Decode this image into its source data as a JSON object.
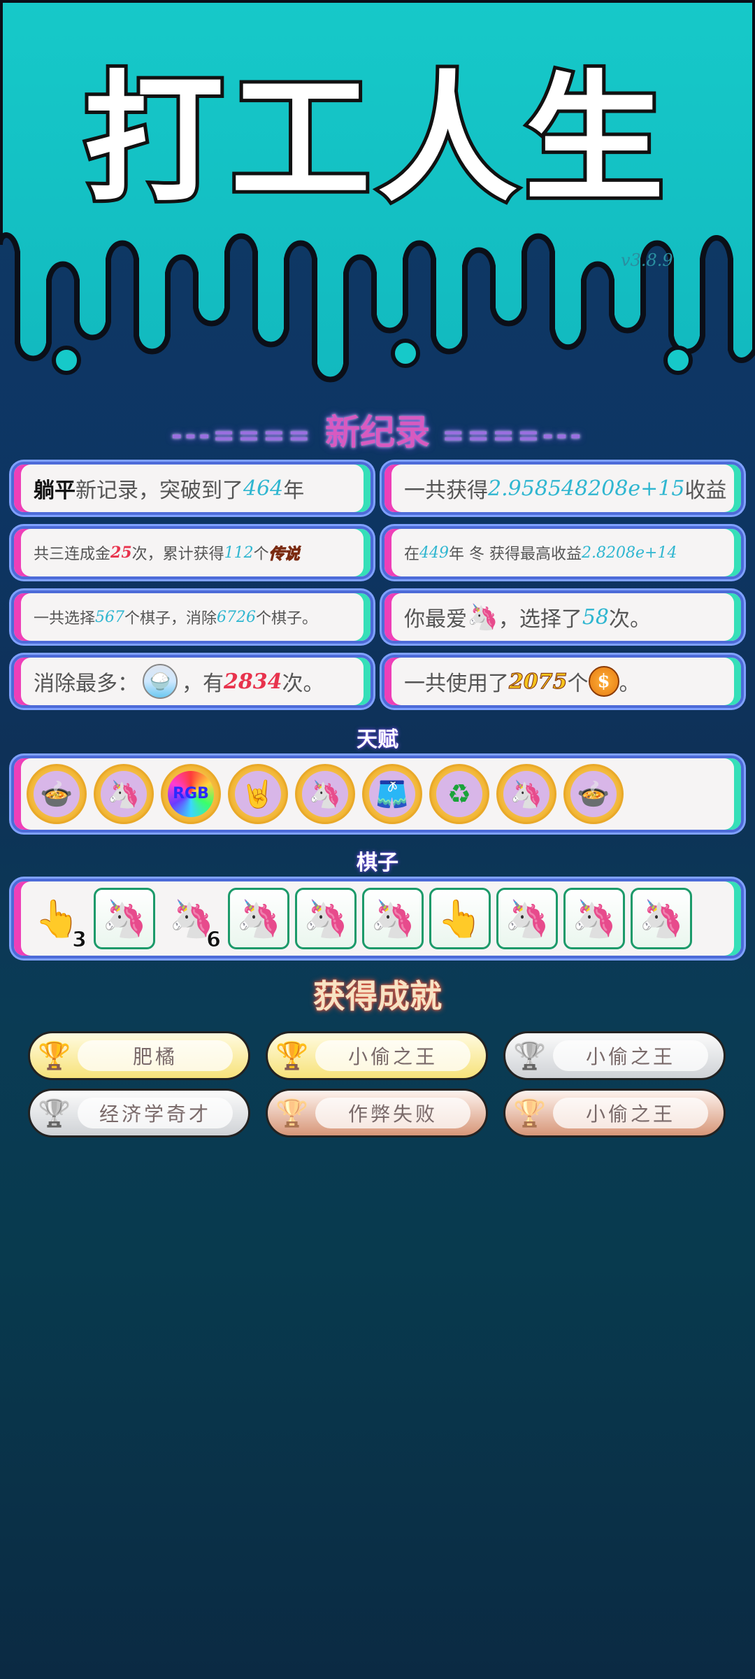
{
  "app": {
    "title": "打工人生",
    "version": "v3.8.9"
  },
  "colors": {
    "top_band": "#14c4c6",
    "card_border": "#4d6bd8",
    "card_left_accent": "#ee3fb8",
    "card_right_accent": "#35dfb8",
    "number_cyan": "#2fb6d0",
    "number_red": "#e8334d"
  },
  "record_header": {
    "left_dashes": "---====",
    "label": "新纪录",
    "right_dashes": "====---"
  },
  "records": [
    {
      "prefix_bold": "躺平",
      "text_a": "新记录，突破到了",
      "num": "464",
      "text_b": "年"
    },
    {
      "text_a": "一共获得",
      "num": "2.958548208e+15",
      "text_b": "收益"
    },
    {
      "text_a": "共三连成金",
      "num": "25",
      "text_b": "次，累计获得",
      "num2": "112",
      "text_c": "个",
      "tag": "传说"
    },
    {
      "text_a": "在",
      "num": "449",
      "text_b": "年 冬 获得最高收益",
      "num2": "2.8208e+14"
    },
    {
      "text_a": "一共选择",
      "num": "567",
      "text_b": "个棋子，消除",
      "num2": "6726",
      "text_c": "个棋子。"
    },
    {
      "text_a": "你最爱",
      "icon": "unicorn-icon",
      "text_b": "，选择了",
      "num": "58",
      "text_c": "次。"
    },
    {
      "text_a": "消除最多：",
      "icon": "rice-bowl-icon",
      "text_b": "，有",
      "num": "2834",
      "text_c": "次。"
    },
    {
      "text_a": "一共使用了",
      "num": "2075",
      "text_b": "个",
      "icon": "coin-icon",
      "coin_symbol": "$",
      "text_c": "。"
    }
  ],
  "talents": {
    "label": "天赋",
    "items": [
      {
        "icon": "bowl-split-icon",
        "glyph": "🍲"
      },
      {
        "icon": "unicorn-coin-icon",
        "glyph": "🦄"
      },
      {
        "icon": "rgb-icon",
        "glyph": "RGB"
      },
      {
        "icon": "rock-hand-icon",
        "glyph": "🤘"
      },
      {
        "icon": "unicorn-coin-icon",
        "glyph": "🦄"
      },
      {
        "icon": "skirt-icon",
        "glyph": "🩳"
      },
      {
        "icon": "recycle-icon",
        "glyph": "♻"
      },
      {
        "icon": "unicorn-coin-icon",
        "glyph": "🦄"
      },
      {
        "icon": "bowl-split-icon",
        "glyph": "🍲"
      }
    ]
  },
  "pieces": {
    "label": "棋子",
    "items": [
      {
        "icon": "pointing-hand-icon",
        "glyph": "👆",
        "count": "3",
        "framed": false
      },
      {
        "icon": "unicorn-icon",
        "glyph": "🦄",
        "count": "",
        "framed": true
      },
      {
        "icon": "unicorn-icon",
        "glyph": "🦄",
        "count": "6",
        "framed": false
      },
      {
        "icon": "unicorn-icon",
        "glyph": "🦄",
        "count": "",
        "framed": true
      },
      {
        "icon": "unicorn-icon",
        "glyph": "🦄",
        "count": "",
        "framed": true
      },
      {
        "icon": "unicorn-icon",
        "glyph": "🦄",
        "count": "",
        "framed": true
      },
      {
        "icon": "pointing-hand-icon",
        "glyph": "👆",
        "count": "",
        "framed": true
      },
      {
        "icon": "unicorn-icon",
        "glyph": "🦄",
        "count": "",
        "framed": true
      },
      {
        "icon": "unicorn-icon",
        "glyph": "🦄",
        "count": "",
        "framed": true
      },
      {
        "icon": "unicorn-icon",
        "glyph": "🦄",
        "count": "",
        "framed": true
      }
    ]
  },
  "achievements": {
    "title": "获得成就",
    "items": [
      {
        "label": "肥橘",
        "tier": "gold"
      },
      {
        "label": "小偷之王",
        "tier": "gold"
      },
      {
        "label": "小偷之王",
        "tier": "silver"
      },
      {
        "label": "经济学奇才",
        "tier": "silver"
      },
      {
        "label": "作弊失败",
        "tier": "bronze"
      },
      {
        "label": "小偷之王",
        "tier": "bronze"
      }
    ]
  }
}
